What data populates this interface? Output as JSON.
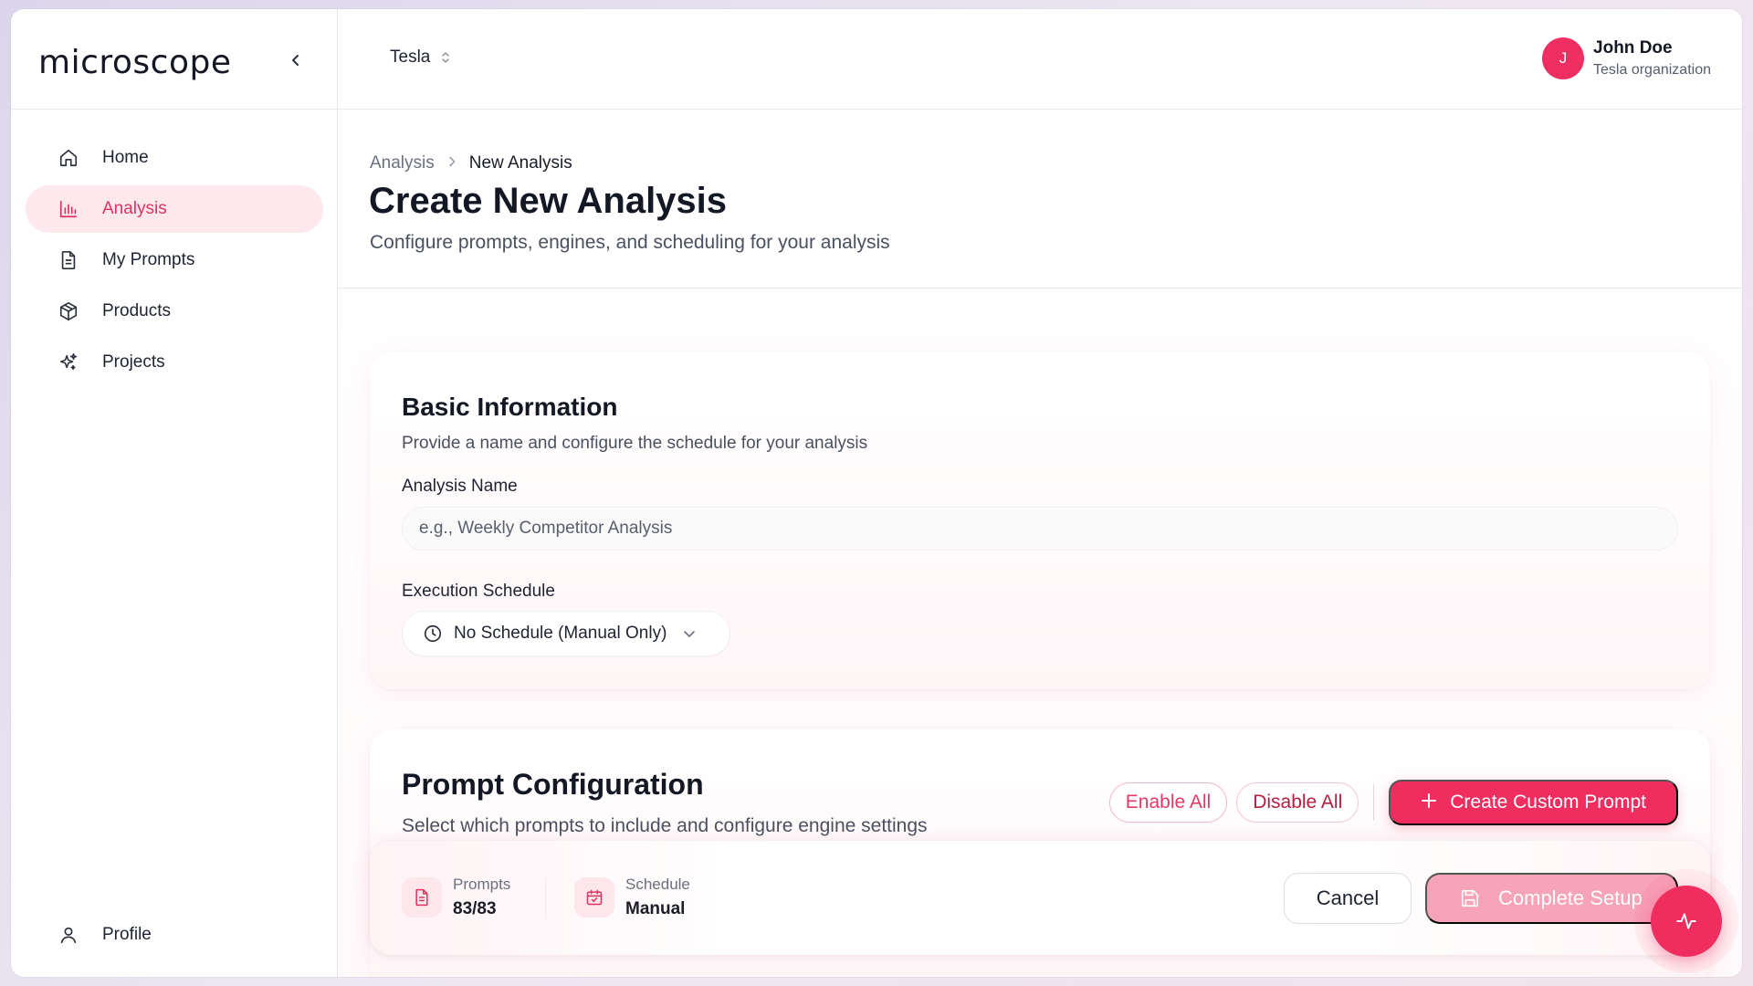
{
  "app": {
    "logo_text": "microscope",
    "accent_color": "#f02d5f"
  },
  "sidebar": {
    "items": [
      {
        "label": "Home",
        "icon": "home-icon"
      },
      {
        "label": "Analysis",
        "icon": "bar-chart-icon",
        "active": true
      },
      {
        "label": "My Prompts",
        "icon": "document-icon"
      },
      {
        "label": "Products",
        "icon": "box-icon"
      },
      {
        "label": "Projects",
        "icon": "sparkles-icon"
      }
    ],
    "bottom": {
      "label": "Profile",
      "icon": "user-icon"
    }
  },
  "topbar": {
    "org": "Tesla",
    "user": {
      "initial": "J",
      "name": "John Doe",
      "org": "Tesla organization"
    }
  },
  "header": {
    "breadcrumb": [
      "Analysis",
      "New Analysis"
    ],
    "title": "Create New Analysis",
    "subtitle": "Configure prompts, engines, and scheduling for your analysis"
  },
  "basic": {
    "title": "Basic Information",
    "subtitle": "Provide a name and configure the schedule for your analysis",
    "name_label": "Analysis Name",
    "name_placeholder": "e.g., Weekly Competitor Analysis",
    "schedule_label": "Execution Schedule",
    "schedule_value": "No Schedule (Manual Only)"
  },
  "prompts": {
    "title": "Prompt Configuration",
    "subtitle": "Select which prompts to include and configure engine settings",
    "enable_all": "Enable All",
    "disable_all": "Disable All",
    "create_custom": "Create Custom Prompt"
  },
  "footer": {
    "prompts_label": "Prompts",
    "prompts_value": "83/83",
    "schedule_label": "Schedule",
    "schedule_value": "Manual",
    "cancel": "Cancel",
    "complete": "Complete Setup"
  }
}
